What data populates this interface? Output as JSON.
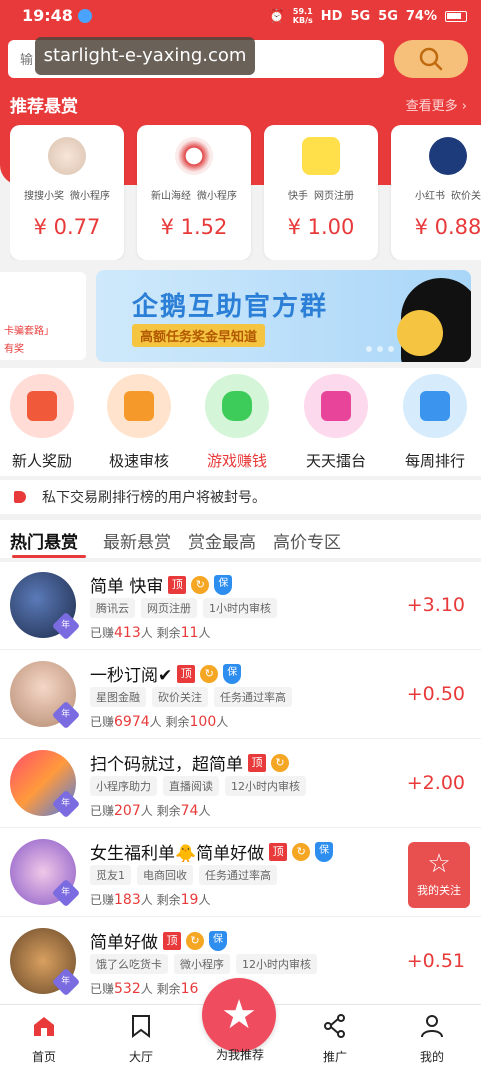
{
  "status": {
    "time": "19:48",
    "speed_value": "59.1",
    "speed_unit": "KB/s",
    "net1": "HD",
    "net2": "5G",
    "net3": "5G",
    "battery": "74%"
  },
  "search": {
    "placeholder": "输",
    "watermark": "starlight-e-yaxing.com"
  },
  "recommend": {
    "title": "推荐悬赏",
    "more": "查看更多 ›"
  },
  "task_cards": [
    {
      "tags": [
        "搜搜小奖",
        "微小程序"
      ],
      "price": "¥ 0.77"
    },
    {
      "tags": [
        "新山海经",
        "微小程序"
      ],
      "price": "¥ 1.52"
    },
    {
      "tags": [
        "快手",
        "网页注册"
      ],
      "price": "¥ 1.00"
    },
    {
      "tags": [
        "小红书",
        "砍价关"
      ],
      "price": "¥ 0.88"
    }
  ],
  "banner": {
    "left_line1": "卡骗套路」",
    "left_line2": "有奖",
    "title": "企鹅互助官方群",
    "subtitle": "高额任务奖金早知道"
  },
  "categories": [
    {
      "label": "新人奖励"
    },
    {
      "label": "极速审核"
    },
    {
      "label": "游戏赚钱"
    },
    {
      "label": "天天擂台"
    },
    {
      "label": "每周排行"
    }
  ],
  "notice": "私下交易刷排行榜的用户将被封号。",
  "tabs": [
    "热门悬赏",
    "最新悬赏",
    "赏金最高",
    "高价专区"
  ],
  "list": [
    {
      "title": "简单 快审",
      "tags": [
        "腾讯云",
        "网页注册",
        "1小时内审核"
      ],
      "earned_label": "已赚",
      "earned": "413",
      "unit1": "人",
      "remain_label": "剩余",
      "remain": "11",
      "unit2": "人",
      "reward": "+3.10",
      "badge_ding": "顶",
      "badge_bao": "保",
      "year": "年"
    },
    {
      "title": "一秒订阅✔",
      "tags": [
        "星图金融",
        "砍价关注",
        "任务通过率高"
      ],
      "earned_label": "已赚",
      "earned": "6974",
      "unit1": "人",
      "remain_label": "剩余",
      "remain": "100",
      "unit2": "人",
      "reward": "+0.50",
      "badge_ding": "顶",
      "badge_bao": "保",
      "year": "年"
    },
    {
      "title": "扫个码就过，超简单",
      "tags": [
        "小程序助力",
        "直播阅读",
        "12小时内审核"
      ],
      "earned_label": "已赚",
      "earned": "207",
      "unit1": "人",
      "remain_label": "剩余",
      "remain": "74",
      "unit2": "人",
      "reward": "+2.00",
      "badge_ding": "顶",
      "badge_bao": "",
      "year": "年"
    },
    {
      "title": "女生福利单🐥简单好做",
      "tags": [
        "觅友1",
        "电商回收",
        "任务通过率高"
      ],
      "earned_label": "已赚",
      "earned": "183",
      "unit1": "人",
      "remain_label": "剩余",
      "remain": "19",
      "unit2": "人",
      "reward": "",
      "badge_ding": "顶",
      "badge_bao": "保",
      "year": "年"
    },
    {
      "title": "简单好做",
      "tags": [
        "饿了么吃货卡",
        "微小程序",
        "12小时内审核"
      ],
      "earned_label": "已赚",
      "earned": "532",
      "unit1": "人",
      "remain_label": "剩余",
      "remain": "16",
      "unit2": "",
      "reward": "+0.51",
      "badge_ding": "顶",
      "badge_bao": "保",
      "year": "年"
    }
  ],
  "follow": {
    "label": "我的关注"
  },
  "nav": {
    "home": "首页",
    "hall": "大厅",
    "center": "为我推荐",
    "promote": "推广",
    "mine": "我的"
  },
  "colors": {
    "brand_red": "#e83a3a",
    "search_button": "#f7c07a",
    "blue_badge": "#2e8ef0"
  }
}
